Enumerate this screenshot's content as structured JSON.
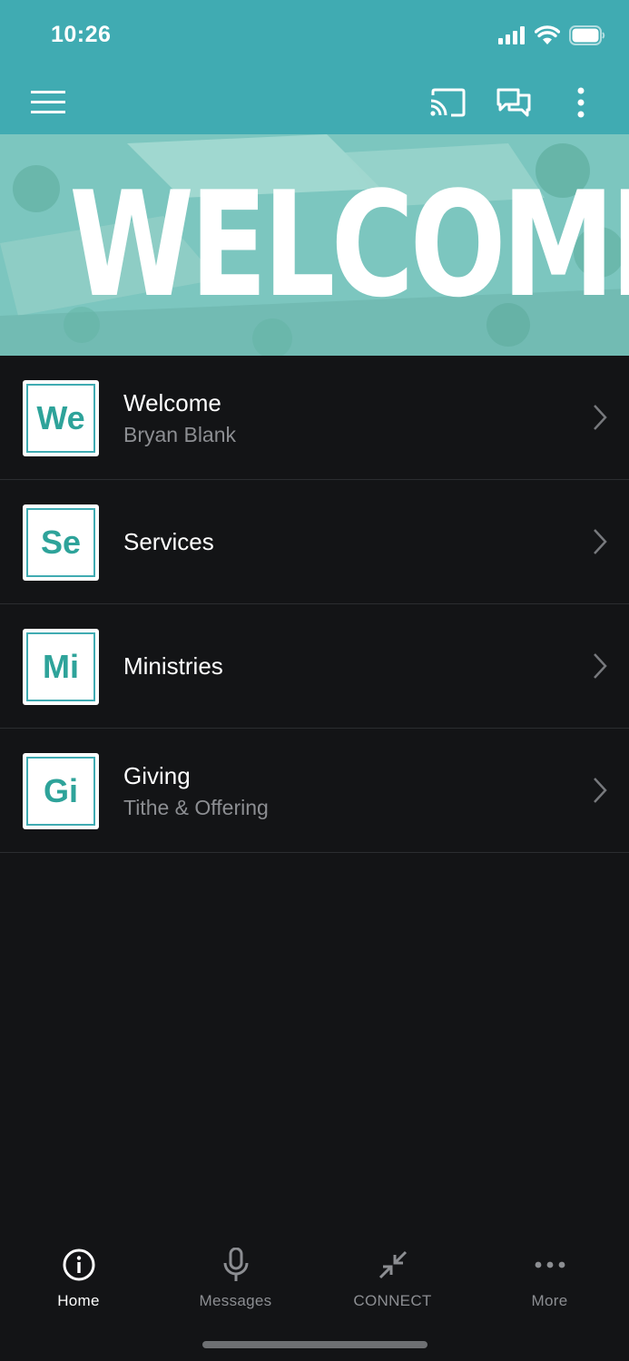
{
  "status_bar": {
    "time": "10:26"
  },
  "app_bar": {
    "menu_icon": "hamburger-icon",
    "cast_icon": "cast-icon",
    "chat_icon": "chat-icon",
    "more_icon": "more-vert-icon"
  },
  "hero": {
    "title": "WELCOME"
  },
  "list": {
    "items": [
      {
        "abbr": "We",
        "title": "Welcome",
        "subtitle": "Bryan Blank"
      },
      {
        "abbr": "Se",
        "title": "Services",
        "subtitle": ""
      },
      {
        "abbr": "Mi",
        "title": "Ministries",
        "subtitle": ""
      },
      {
        "abbr": "Gi",
        "title": "Giving",
        "subtitle": "Tithe & Offering"
      }
    ]
  },
  "tabs": [
    {
      "label": "Home",
      "icon": "info-icon",
      "active": true
    },
    {
      "label": "Messages",
      "icon": "microphone-icon",
      "active": false
    },
    {
      "label": "CONNECT",
      "icon": "arrows-inward-icon",
      "active": false
    },
    {
      "label": "More",
      "icon": "more-horiz-icon",
      "active": false
    }
  ],
  "colors": {
    "accent": "#40abb2",
    "background": "#131416",
    "tile_text": "#2ea39a"
  }
}
